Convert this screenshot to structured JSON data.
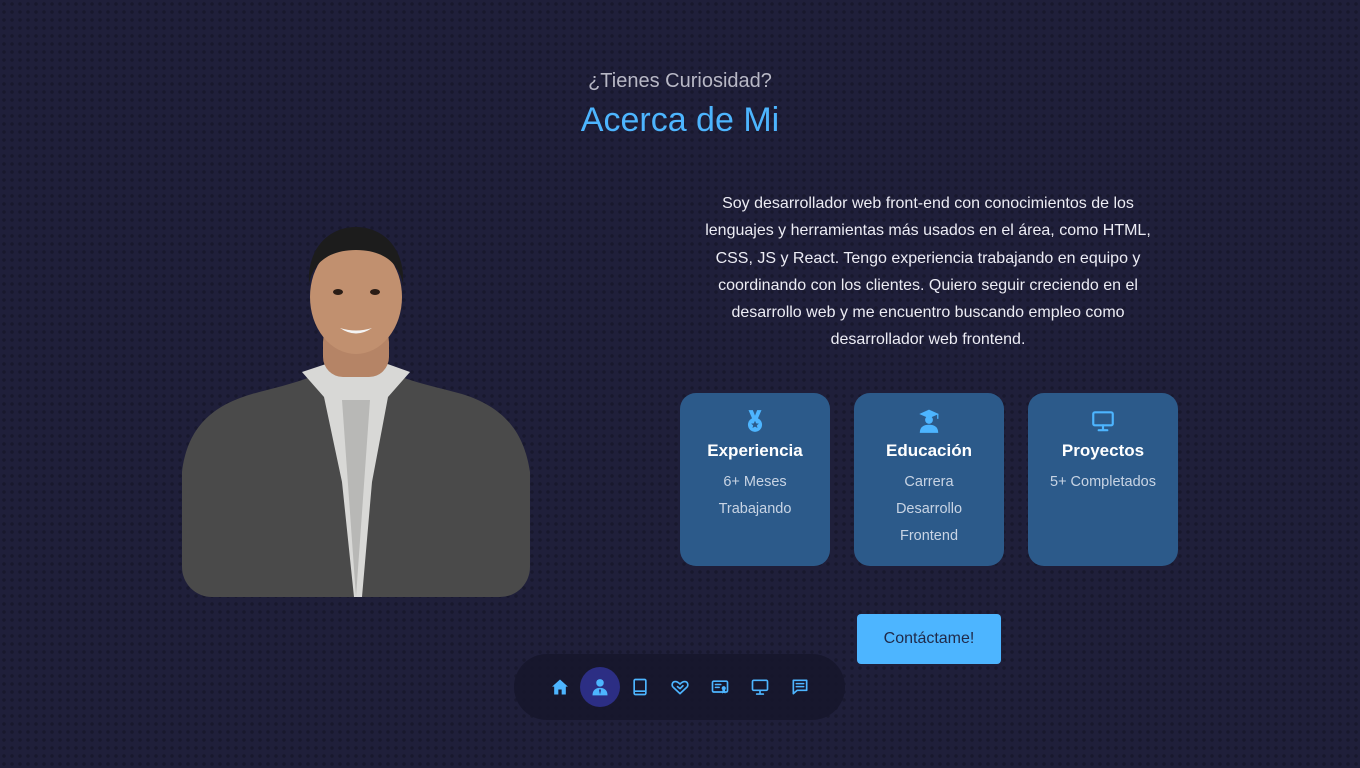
{
  "header": {
    "subtitle": "¿Tienes Curiosidad?",
    "title": "Acerca de Mi"
  },
  "about": {
    "bio_lines": [
      "Soy desarrollador web front-end con conocimientos de los",
      "lenguajes y herramientas más usados en el área, como HTML,",
      "CSS, JS y React. Tengo experiencia trabajando en equipo y",
      "coordinando con los clientes. Quiero seguir creciendo en el",
      "desarrollo web y me encuentro buscando empleo como",
      "desarrollador web frontend."
    ],
    "cards": [
      {
        "icon": "award-medal-icon",
        "title": "Experiencia",
        "lines": [
          "6+ Meses",
          "Trabajando"
        ]
      },
      {
        "icon": "graduate-icon",
        "title": "Educación",
        "lines": [
          "Carrera",
          "Desarrollo",
          "Frontend"
        ]
      },
      {
        "icon": "monitor-icon",
        "title": "Proyectos",
        "lines": [
          "5+ Completados"
        ]
      }
    ],
    "cta_label": "Contáctame!"
  },
  "nav": {
    "items": [
      {
        "icon": "home-icon",
        "active": false
      },
      {
        "icon": "user-icon",
        "active": true
      },
      {
        "icon": "book-icon",
        "active": false
      },
      {
        "icon": "heart-hands-icon",
        "active": false
      },
      {
        "icon": "certificate-icon",
        "active": false
      },
      {
        "icon": "monitor-icon",
        "active": false
      },
      {
        "icon": "chat-icon",
        "active": false
      }
    ]
  },
  "colors": {
    "accent": "#4db5ff",
    "background": "#1f1f3a",
    "card": "#2c5a8a",
    "nav_active": "#2c2e84"
  }
}
